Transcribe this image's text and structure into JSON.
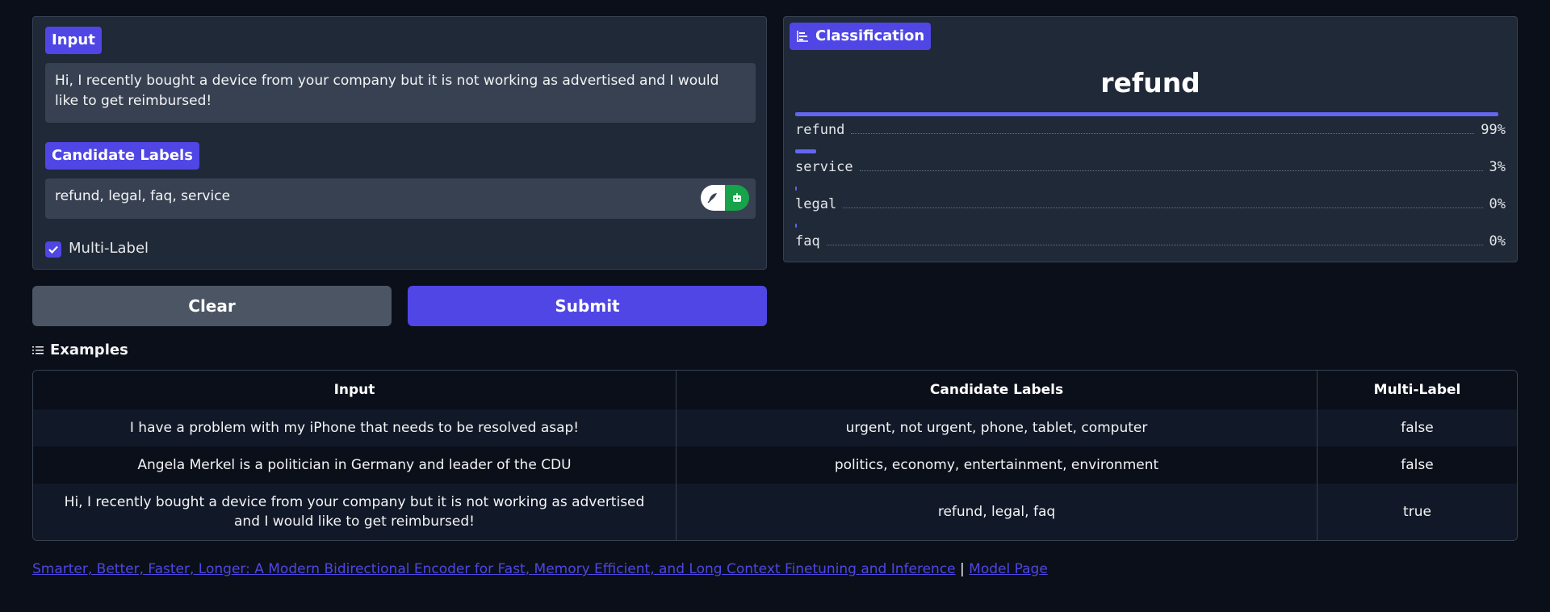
{
  "input": {
    "tag": "Input",
    "value": "Hi, I recently bought a device from your company but it is not working as advertised and I would like to get reimbursed!"
  },
  "labels": {
    "tag": "Candidate Labels",
    "value": "refund, legal, faq, service"
  },
  "multi_label": {
    "label": "Multi-Label",
    "checked": true
  },
  "buttons": {
    "clear": "Clear",
    "submit": "Submit"
  },
  "classification": {
    "tag": "Classification",
    "top_label": "refund",
    "results": [
      {
        "label": "refund",
        "pct": "99%",
        "fraction": 0.99
      },
      {
        "label": "service",
        "pct": "3%",
        "fraction": 0.03
      },
      {
        "label": "legal",
        "pct": "0%",
        "fraction": 0.0
      },
      {
        "label": "faq",
        "pct": "0%",
        "fraction": 0.0
      }
    ]
  },
  "examples": {
    "title": "Examples",
    "headers": [
      "Input",
      "Candidate Labels",
      "Multi-Label"
    ],
    "rows": [
      [
        "I have a problem with my iPhone that needs to be resolved asap!",
        "urgent, not urgent, phone, tablet, computer",
        "false"
      ],
      [
        "Angela Merkel is a politician in Germany and leader of the CDU",
        "politics, economy, entertainment, environment",
        "false"
      ],
      [
        "Hi, I recently bought a device from your company but it is not working as advertised and I would like to get reimbursed!",
        "refund, legal, faq",
        "true"
      ]
    ]
  },
  "footer": {
    "paper_link": "Smarter, Better, Faster, Longer: A Modern Bidirectional Encoder for Fast, Memory Efficient, and Long Context Finetuning and Inference",
    "separator": "|",
    "model_link": "Model Page"
  },
  "colors": {
    "accent": "#4f46e5",
    "background": "#0b0f19",
    "panel": "#1f2937"
  }
}
